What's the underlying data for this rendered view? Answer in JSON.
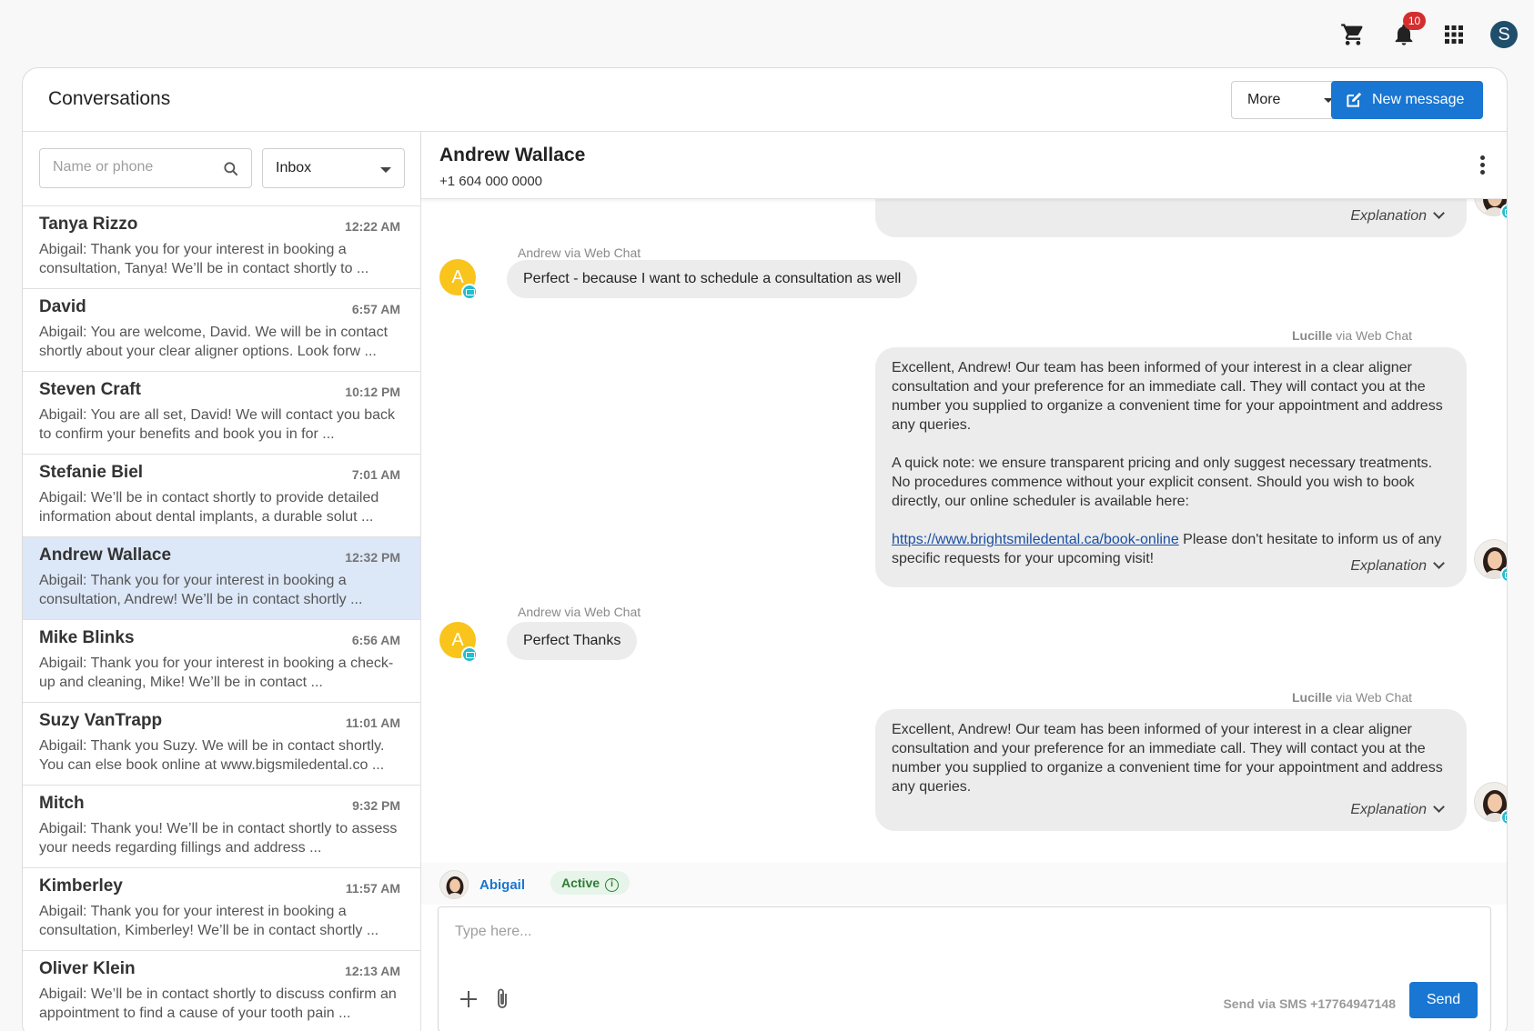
{
  "topbar": {
    "notification_count": "10",
    "user_initial": "S",
    "icons": [
      "cart-icon",
      "bell-icon",
      "apps-grid-icon"
    ]
  },
  "header": {
    "title": "Conversations",
    "more_label": "More",
    "new_message_label": "New message"
  },
  "sidebar": {
    "search_placeholder": "Name or phone",
    "folder_selected": "Inbox",
    "conversations": [
      {
        "name": "Tanya Rizzo",
        "time": "12:22 AM",
        "preview": "Abigail: Thank you for your interest in booking a consultation, Tanya! We’ll be in contact shortly to ..."
      },
      {
        "name": "David",
        "time": "6:57 AM",
        "preview": "Abigail: You are welcome, David. We will be in contact shortly about your clear aligner options. Look forw ..."
      },
      {
        "name": "Steven Craft",
        "time": "10:12 PM",
        "preview": "Abigail: You are all set, David! We will contact you back to confirm your benefits and book you in for ..."
      },
      {
        "name": "Stefanie Biel",
        "time": "7:01 AM",
        "preview": "Abigail: We’ll be in contact shortly to provide detailed information about dental implants, a durable solut ..."
      },
      {
        "name": "Andrew Wallace",
        "time": "12:32 PM",
        "preview": "Abigail: Thank you for your interest in booking a consultation, Andrew! We’ll be in contact shortly ..."
      },
      {
        "name": "Mike Blinks",
        "time": "6:56 AM",
        "preview": "Abigail: Thank you for your interest in booking a check-up and cleaning, Mike! We’ll be in contact ..."
      },
      {
        "name": "Suzy VanTrapp",
        "time": "11:01 AM",
        "preview": "Abigail: Thank you Suzy. We will be in contact shortly. You can else book online at www.bigsmiledental.co ..."
      },
      {
        "name": "Mitch",
        "time": "9:32 PM",
        "preview": "Abigail: Thank you! We’ll be in contact shortly to assess your needs regarding fillings and address ..."
      },
      {
        "name": "Kimberley",
        "time": "11:57 AM",
        "preview": "Abigail: Thank you for your interest in booking a consultation, Kimberley! We’ll be in contact shortly ..."
      },
      {
        "name": "Oliver Klein",
        "time": "12:13 AM",
        "preview": "Abigail: We’ll be in contact shortly to discuss confirm an appointment to find a cause of your tooth pain ..."
      }
    ]
  },
  "chat": {
    "contact_name": "Andrew Wallace",
    "contact_phone": "+1 604 000 0000",
    "explanation_label": "Explanation",
    "messages": {
      "in1_sender": "Andrew via Web Chat",
      "in1_text": "Perfect - because I want to schedule a consultation as well",
      "avatar_letter": "A",
      "out1_sender_name": "Lucille",
      "out1_sender_via": " via Web Chat",
      "out1_p1": "Excellent, Andrew! Our team has been informed of your interest in a clear aligner consultation and your preference for an immediate call. They will contact you at the number you supplied to organize a convenient time for your appointment and address any queries.",
      "out1_p2": "A quick note: we ensure transparent pricing and only suggest necessary treatments. No procedures commence without your explicit consent. Should you wish to book directly, our online scheduler is available here:",
      "out1_link": "https://www.brightsmiledental.ca/book-online",
      "out1_p3": " Please don't hesitate to inform us of any specific requests for your upcoming visit!",
      "in2_sender": "Andrew via Web Chat",
      "in2_text": "Perfect Thanks",
      "out2_sender_name": "Lucille",
      "out2_sender_via": " via Web Chat",
      "out2_text": "Excellent, Andrew! Our team has been informed of your interest in a clear aligner consultation and your preference for an immediate call. They will contact you at the number you supplied to organize a convenient time for your appointment and address any queries."
    }
  },
  "composer": {
    "agent_name": "Abigail",
    "status": "Active",
    "placeholder": "Type here...",
    "send_via": "Send via SMS +17764947148",
    "send_label": "Send"
  },
  "colors": {
    "accent": "#1976d2",
    "selected_row": "#dce7f7",
    "avatar_yellow": "#f9c41b",
    "badge_red": "#d32f2f",
    "active_green": "#2e7d32"
  }
}
